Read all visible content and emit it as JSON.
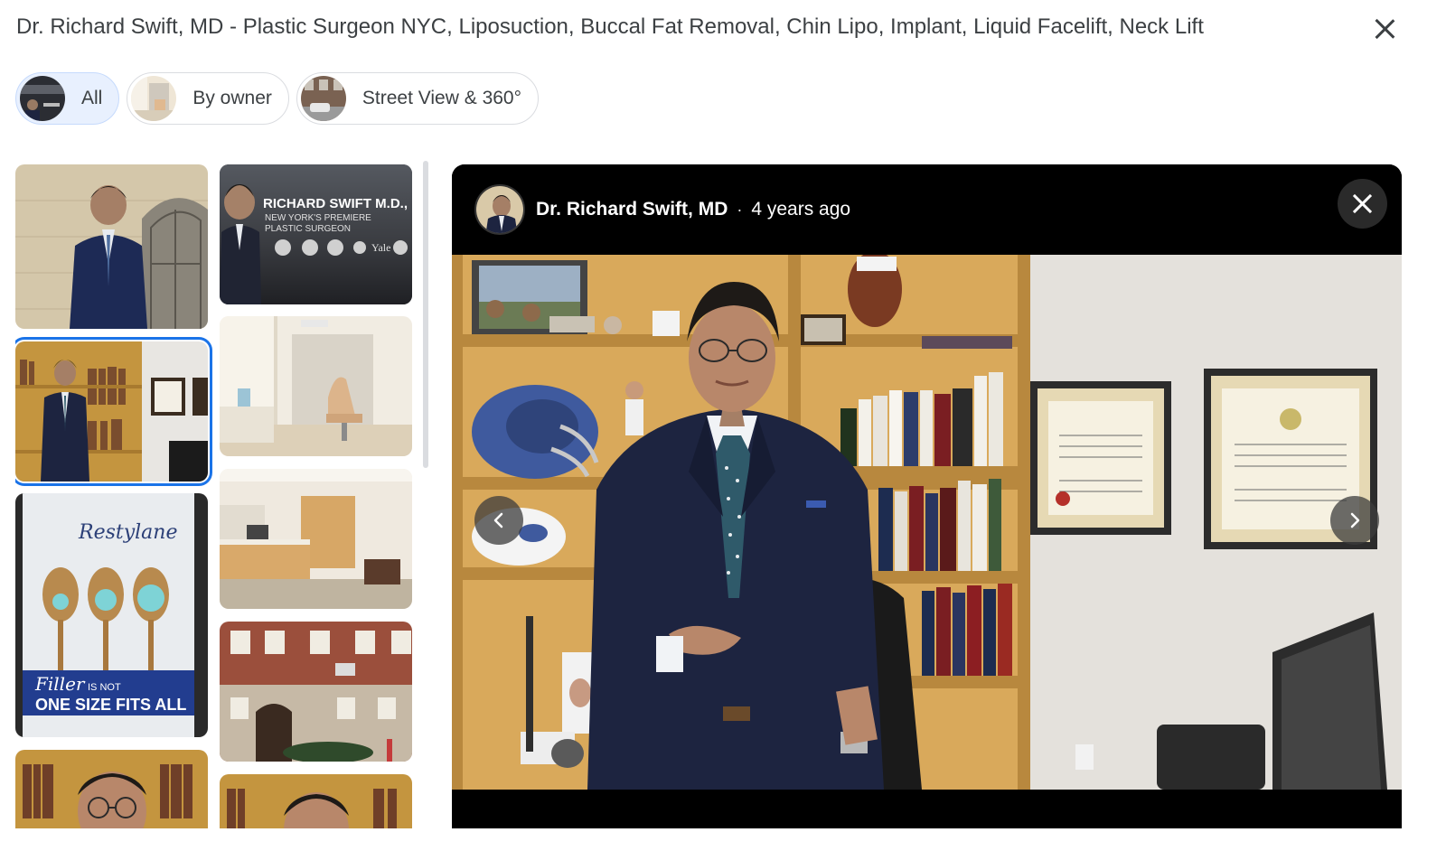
{
  "header": {
    "title": "Dr. Richard Swift, MD - Plastic Surgeon NYC, Liposuction, Buccal Fat Removal, Chin Lipo, Implant, Liquid Facelift, Neck Lift",
    "close_icon": "close-icon"
  },
  "filters": [
    {
      "label": "All",
      "active": true
    },
    {
      "label": "By owner",
      "active": false
    },
    {
      "label": "Street View & 360°",
      "active": false
    }
  ],
  "gallery": {
    "photos": [
      {
        "name": "photo-doctor-exterior"
      },
      {
        "name": "photo-doctor-banner",
        "banner_title": "RICHARD SWIFT M.D.,",
        "banner_line1": "NEW YORK'S PREMIERE",
        "banner_line2": "PLASTIC SURGEON",
        "banner_logo": "Yale"
      },
      {
        "name": "photo-doctor-office",
        "selected": true
      },
      {
        "name": "photo-exam-room"
      },
      {
        "name": "photo-restylane-poster",
        "brand": "Restylane",
        "slogan_1": "Filler",
        "slogan_2": "IS NOT",
        "slogan_3": "ONE SIZE FITS ALL"
      },
      {
        "name": "photo-reception"
      },
      {
        "name": "photo-building-exterior"
      },
      {
        "name": "photo-doctor-glasses-1"
      },
      {
        "name": "photo-doctor-glasses-2"
      }
    ]
  },
  "viewer": {
    "author_name": "Dr. Richard Swift, MD",
    "separator": "·",
    "timestamp": "4 years ago",
    "prev_icon": "chevron-left-icon",
    "next_icon": "chevron-right-icon",
    "close_icon": "close-icon"
  },
  "colors": {
    "accent": "#1a73e8",
    "chip_active_bg": "#e8f0fe",
    "viewer_bg": "#000000",
    "shelf_wood": "#d9a95b",
    "suit_navy": "#1d2440"
  }
}
